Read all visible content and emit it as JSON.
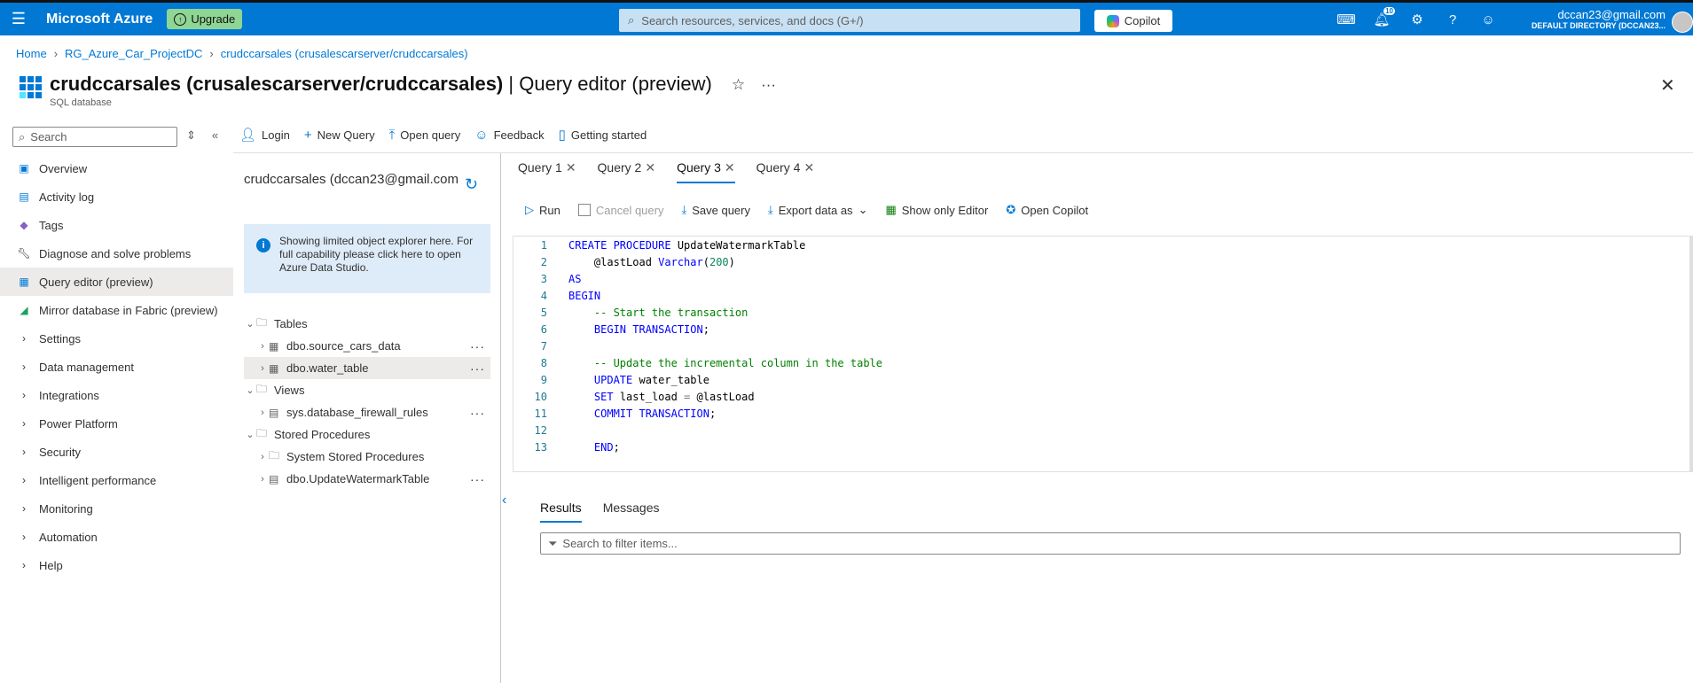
{
  "topbar": {
    "brand": "Microsoft Azure",
    "upgrade_label": "Upgrade",
    "search_placeholder": "Search resources, services, and docs (G+/)",
    "copilot_label": "Copilot",
    "notifications_count": "10",
    "account_email": "dccan23@gmail.com",
    "account_directory": "DEFAULT DIRECTORY (DCCAN23...",
    "accent_color": "#0078d4"
  },
  "breadcrumb": [
    "Home",
    "RG_Azure_Car_ProjectDC",
    "crudccarsales (crusalescarserver/crudccarsales)"
  ],
  "page": {
    "title": "crudccarsales (crusalescarserver/crudccarsales)",
    "title_suffix": "| Query editor (preview)",
    "subtitle": "SQL database"
  },
  "left_search_placeholder": "Search",
  "nav": [
    {
      "label": "Overview",
      "icon": "sql-icon"
    },
    {
      "label": "Activity log",
      "icon": "activity-log-icon"
    },
    {
      "label": "Tags",
      "icon": "tag-icon"
    },
    {
      "label": "Diagnose and solve problems",
      "icon": "wrench-icon"
    },
    {
      "label": "Query editor (preview)",
      "icon": "query-editor-icon",
      "active": true
    },
    {
      "label": "Mirror database in Fabric (preview)",
      "icon": "fabric-icon"
    },
    {
      "label": "Settings",
      "icon": "chevron-right-icon"
    },
    {
      "label": "Data management",
      "icon": "chevron-right-icon"
    },
    {
      "label": "Integrations",
      "icon": "chevron-right-icon"
    },
    {
      "label": "Power Platform",
      "icon": "chevron-right-icon"
    },
    {
      "label": "Security",
      "icon": "chevron-right-icon"
    },
    {
      "label": "Intelligent performance",
      "icon": "chevron-right-icon"
    },
    {
      "label": "Monitoring",
      "icon": "chevron-right-icon"
    },
    {
      "label": "Automation",
      "icon": "chevron-right-icon"
    },
    {
      "label": "Help",
      "icon": "chevron-right-icon"
    }
  ],
  "toolbar": {
    "login": "Login",
    "new_query": "New Query",
    "open_query": "Open query",
    "feedback": "Feedback",
    "getting_started": "Getting started"
  },
  "explorer": {
    "header": "crudccarsales (dccan23@gmail.com",
    "info": "Showing limited object explorer here. For full capability please click here to open Azure Data Studio.",
    "tree": [
      {
        "label": "Tables",
        "level": 0,
        "expanded": true
      },
      {
        "label": "dbo.source_cars_data",
        "level": 1
      },
      {
        "label": "dbo.water_table",
        "level": 1,
        "selected": true
      },
      {
        "label": "Views",
        "level": 0,
        "expanded": true
      },
      {
        "label": "sys.database_firewall_rules",
        "level": 1
      },
      {
        "label": "Stored Procedures",
        "level": 0,
        "expanded": true
      },
      {
        "label": "System Stored Procedures",
        "level": 1
      },
      {
        "label": "dbo.UpdateWatermarkTable",
        "level": 1
      }
    ]
  },
  "query_tabs": [
    "Query 1",
    "Query 2",
    "Query 3",
    "Query 4"
  ],
  "active_query_tab": "Query 3",
  "query_toolbar": {
    "run": "Run",
    "cancel": "Cancel query",
    "save": "Save query",
    "export": "Export data as",
    "show_only_editor": "Show only Editor",
    "open_copilot": "Open Copilot"
  },
  "code_lines": [
    "CREATE PROCEDURE UpdateWatermarkTable",
    "    @lastLoad Varchar(200)",
    "AS",
    "BEGIN",
    "    -- Start the transaction",
    "    BEGIN TRANSACTION;",
    "",
    "    -- Update the incremental column in the table",
    "    UPDATE water_table",
    "    SET last_load = @lastLoad",
    "    COMMIT TRANSACTION;",
    "",
    "    END;"
  ],
  "results": {
    "tabs": [
      "Results",
      "Messages"
    ],
    "filter_placeholder": "Search to filter items..."
  }
}
